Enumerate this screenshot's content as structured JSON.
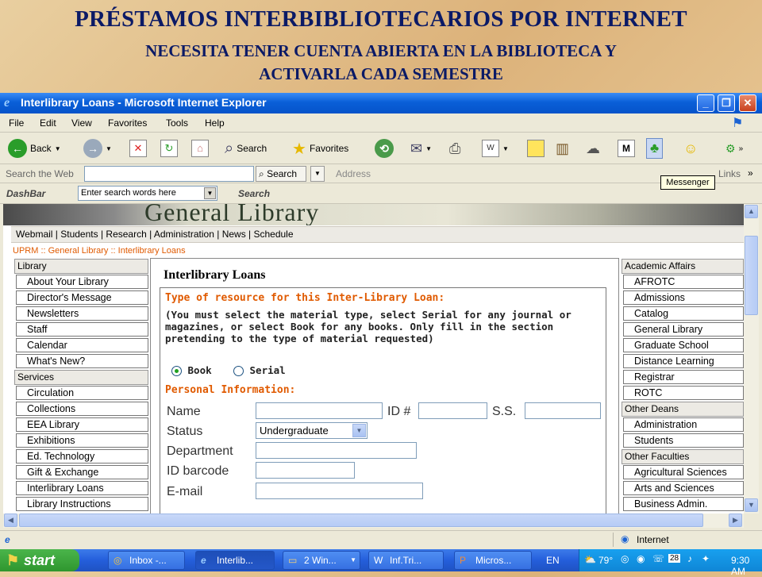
{
  "slide": {
    "title": "PRÉSTAMOS INTERBIBLIOTECARIOS  POR INTERNET",
    "subtitle_line1": "NECESITA TENER CUENTA ABIERTA EN LA BIBLIOTECA Y",
    "subtitle_line2": "ACTIVARLA CADA SEMESTRE"
  },
  "window": {
    "title": "Interlibrary Loans - Microsoft Internet Explorer"
  },
  "menu": [
    "File",
    "Edit",
    "View",
    "Favorites",
    "Tools",
    "Help"
  ],
  "toolbar": {
    "back": "Back",
    "search": "Search",
    "favorites": "Favorites"
  },
  "searchbar": {
    "label": "Search the Web",
    "search_button": "Search",
    "address_label": "Address",
    "links_label": "Links",
    "tooltip": "Messenger"
  },
  "dashbar": {
    "label": "DashBar",
    "input_value": "Enter search words here",
    "search_label": "Search"
  },
  "page": {
    "banner_title": "General Library",
    "nav": "Webmail | Students | Research | Administration | News | Schedule",
    "breadcrumb": "UPRM :: General Library :: Interlibrary Loans",
    "left_sections": [
      {
        "head": "Library",
        "items": [
          "About Your Library",
          "Director's Message",
          "Newsletters",
          "Staff",
          "Calendar",
          "What's New?"
        ]
      },
      {
        "head": "Services",
        "items": [
          "Circulation",
          "Collections",
          "EEA Library",
          "Exhibitions",
          "Ed. Technology",
          "Gift & Exchange",
          "Interlibrary Loans",
          "Library Instructions"
        ]
      }
    ],
    "right_sections": [
      {
        "head": "Academic Affairs",
        "items": [
          "AFROTC",
          "Admissions",
          "Catalog",
          "General Library",
          "Graduate School",
          "Distance Learning",
          "Registrar",
          "ROTC"
        ]
      },
      {
        "head": "Other Deans",
        "items": [
          "Administration",
          "Students"
        ]
      },
      {
        "head": "Other Faculties",
        "items": [
          "Agricultural Sciences",
          "Arts and Sciences",
          "Business Admin."
        ]
      }
    ],
    "form": {
      "title": "Interlibrary Loans",
      "type_heading": "Type of resource for this Inter-Library Loan:",
      "instructions": [
        "(You must select the material type, select Serial for any journal or",
        "magazines, or select Book for any books. Only fill in the section",
        "pretending to the type of material requested)"
      ],
      "radio_book": "Book",
      "radio_serial": "Serial",
      "selected_type": "Book",
      "personal_heading": "Personal Information:",
      "labels": {
        "name": "Name",
        "id": "ID #",
        "ss": "S.S.",
        "status": "Status",
        "department": "Department",
        "barcode": "ID barcode",
        "email": "E-mail"
      },
      "status_value": "Undergraduate"
    }
  },
  "statusbar": {
    "zone": "Internet"
  },
  "taskbar": {
    "start": "start",
    "tasks": [
      "Inbox -...",
      "Interlib...",
      "2 Win...",
      "Inf.Tri...",
      "Micros..."
    ],
    "lang": "EN",
    "temp": "79°",
    "day": "28",
    "clock": "9:30 AM"
  },
  "colors": {
    "slide_text": "#0b1a66",
    "accent_orange": "#e05a00",
    "xp_blue": "#245edb"
  }
}
